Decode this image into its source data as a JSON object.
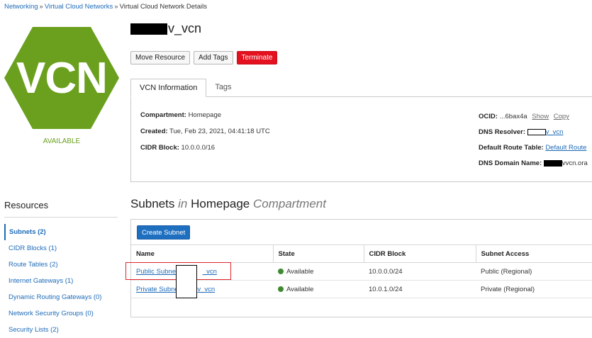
{
  "breadcrumb": {
    "items": [
      "Networking",
      "Virtual Cloud Networks"
    ],
    "current": "Virtual Cloud Network Details",
    "separator": "»"
  },
  "resource_icon": {
    "label": "VCN",
    "color": "#6aa01e",
    "status": "AVAILABLE"
  },
  "header": {
    "title_suffix": "v_vcn"
  },
  "actions": {
    "move_resource": "Move Resource",
    "add_tags": "Add Tags",
    "terminate": "Terminate"
  },
  "tabs": [
    {
      "label": "VCN Information",
      "active": true
    },
    {
      "label": "Tags",
      "active": false
    }
  ],
  "vcn_info": {
    "compartment_label": "Compartment:",
    "compartment_value": "Homepage",
    "created_label": "Created:",
    "created_value": "Tue, Feb 23, 2021, 04:41:18 UTC",
    "cidr_label": "CIDR Block:",
    "cidr_value": "10.0.0.0/16",
    "ocid_label": "OCID:",
    "ocid_value": "...6bax4a",
    "ocid_show": "Show",
    "ocid_copy": "Copy",
    "dns_resolver_label": "DNS Resolver:",
    "dns_resolver_suffix": "v_vcn",
    "route_table_label": "Default Route Table:",
    "route_table_value": "Default Route",
    "dns_domain_label": "DNS Domain Name:",
    "dns_domain_suffix": "vvcn.ora"
  },
  "resources": {
    "title": "Resources",
    "items": [
      {
        "label": "Subnets (2)",
        "active": true
      },
      {
        "label": "CIDR Blocks (1)"
      },
      {
        "label": "Route Tables (2)"
      },
      {
        "label": "Internet Gateways (1)"
      },
      {
        "label": "Dynamic Routing Gateways (0)"
      },
      {
        "label": "Network Security Groups (0)"
      },
      {
        "label": "Security Lists (2)"
      }
    ]
  },
  "subnets": {
    "title_main": "Subnets",
    "title_in": "in",
    "title_compartment": "Homepage",
    "title_suffix": "Compartment",
    "create_button": "Create Subnet",
    "columns": [
      "Name",
      "State",
      "CIDR Block",
      "Subnet Access"
    ],
    "rows": [
      {
        "name_prefix": "Public Subnet-",
        "name_suffix": "_vcn",
        "state": "Available",
        "cidr": "10.0.0.0/24",
        "access": "Public (Regional)"
      },
      {
        "name_prefix": "Private Subnet",
        "name_suffix": "v_vcn",
        "state": "Available",
        "cidr": "10.0.1.0/24",
        "access": "Private (Regional)"
      }
    ]
  }
}
